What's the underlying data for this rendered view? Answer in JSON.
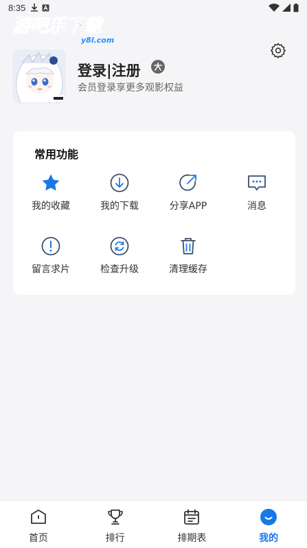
{
  "status_bar": {
    "time": "8:35"
  },
  "brand": {
    "name": "游吧乐下载",
    "domain": "y8l.com"
  },
  "profile": {
    "login_label": "登录|注册",
    "subtitle": "会员登录享更多观影权益"
  },
  "functions_card": {
    "title": "常用功能",
    "items": [
      {
        "label": "我的收藏",
        "icon": "star-icon"
      },
      {
        "label": "我的下载",
        "icon": "download-icon"
      },
      {
        "label": "分享APP",
        "icon": "share-icon"
      },
      {
        "label": "消息",
        "icon": "message-icon"
      },
      {
        "label": "留言求片",
        "icon": "exclamation-icon"
      },
      {
        "label": "检查升级",
        "icon": "refresh-icon"
      },
      {
        "label": "清理缓存",
        "icon": "trash-icon"
      }
    ]
  },
  "tab_bar": {
    "tabs": [
      {
        "label": "首页",
        "icon": "home-icon"
      },
      {
        "label": "排行",
        "icon": "trophy-icon"
      },
      {
        "label": "排期表",
        "icon": "calendar-icon"
      },
      {
        "label": "我的",
        "icon": "smile-icon",
        "active": true
      }
    ]
  },
  "colors": {
    "accent": "#1a78e6",
    "card_bg": "#ffffff",
    "page_bg": "#f5f5f7"
  }
}
